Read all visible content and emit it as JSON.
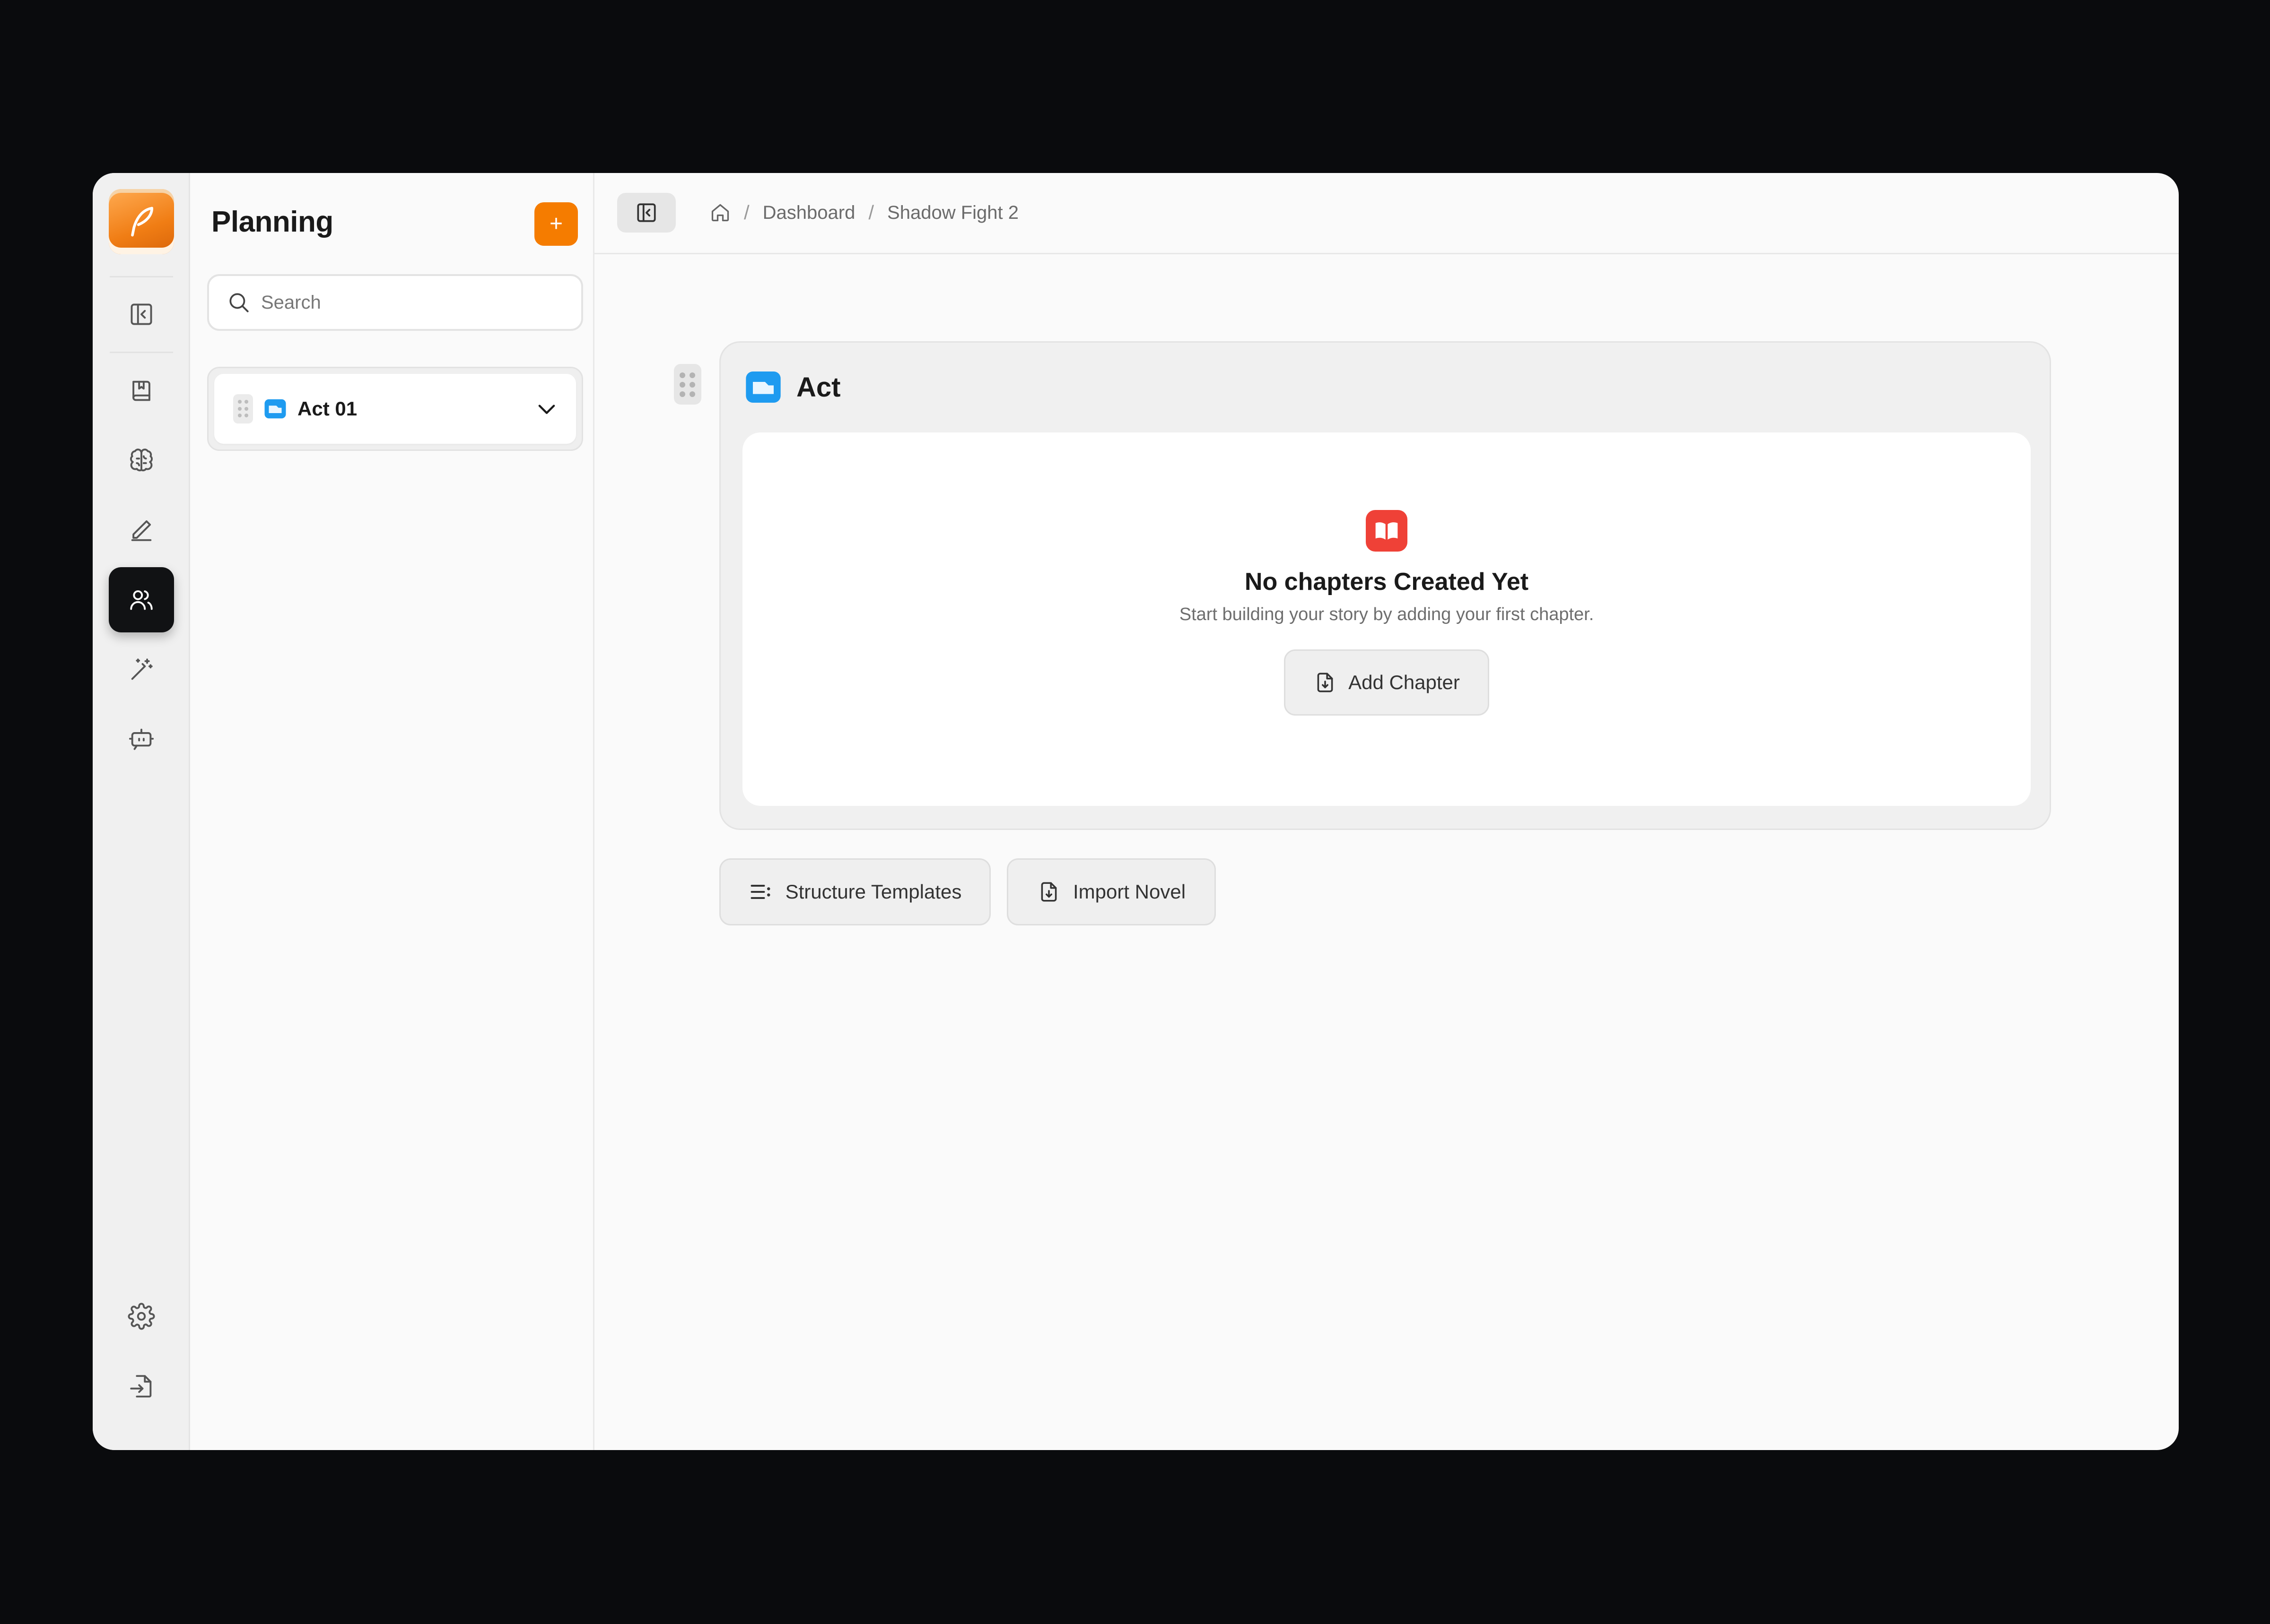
{
  "panel": {
    "title": "Planning",
    "add_label": "+",
    "search_placeholder": "Search",
    "acts": [
      {
        "label": "Act 01"
      }
    ]
  },
  "breadcrumb": {
    "items": [
      "Dashboard",
      "Shadow Fight 2"
    ],
    "separator": "/"
  },
  "act_card": {
    "title": "Act",
    "empty_title": "No chapters Created Yet",
    "empty_subtitle": "Start building your story by adding your first chapter.",
    "add_chapter_label": "Add Chapter"
  },
  "actions": {
    "structure_templates_label": "Structure Templates",
    "import_novel_label": "Import Novel"
  },
  "colors": {
    "accent": "#f57c00",
    "folder_blue": "#1e9bf0",
    "empty_red": "#ef4137",
    "active_rail": "#111214"
  }
}
